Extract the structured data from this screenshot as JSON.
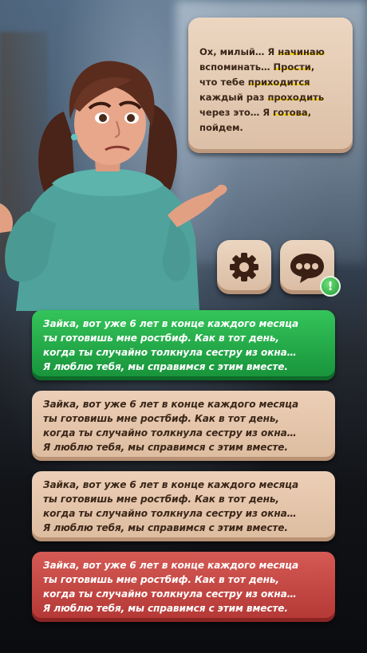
{
  "speech": {
    "l1a": "Ох, милый… Я ",
    "l1b": "начинаю",
    "l2a": "вспоминать… ",
    "l2b": "Прости",
    "l2c": ",",
    "l3a": "что тебе ",
    "l3b": "приходится",
    "l4a": "каждый раз ",
    "l4b": "проходить",
    "l5a": "через это… Я ",
    "l5b": "готова",
    "l5c": ",",
    "l6": "пойдем."
  },
  "buttons": {
    "settings_icon": "gear-icon",
    "chat_icon": "chat-bubble-icon",
    "notify_label": "!"
  },
  "choices": [
    {
      "style": "green",
      "lines": [
        "Зайка, вот уже 6 лет в конце каждого месяца",
        "ты готовишь мне ростбиф. Как в тот день,",
        "когда ты случайно толкнула сестру из окна…",
        "Я люблю тебя, мы справимся с этим вместе."
      ]
    },
    {
      "style": "tan",
      "lines": [
        "Зайка, вот уже 6 лет в конце каждого месяца",
        "ты готовишь мне ростбиф. Как в тот день,",
        "когда ты случайно толкнула сестру из окна…",
        "Я люблю тебя, мы справимся с этим вместе."
      ]
    },
    {
      "style": "tan",
      "lines": [
        "Зайка, вот уже 6 лет в конце каждого месяца",
        "ты готовишь мне ростбиф. Как в тот день,",
        "когда ты случайно толкнула сестру из окна…",
        "Я люблю тебя, мы справимся с этим вместе."
      ]
    },
    {
      "style": "red",
      "lines": [
        "Зайка, вот уже 6 лет в конце каждого месяца",
        "ты готовишь мне ростбиф. Как в тот день,",
        "когда ты случайно толкнула сестру из окна…",
        "Я люблю тебя, мы справимся с этим вместе."
      ]
    }
  ],
  "colors": {
    "green": "#1f9b3f",
    "tan": "#e3c6ad",
    "red": "#c2423f",
    "highlight": "#f0d000"
  }
}
